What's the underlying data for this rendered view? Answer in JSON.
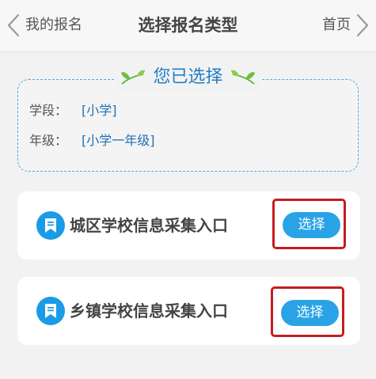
{
  "header": {
    "back_label": "我的报名",
    "title": "选择报名类型",
    "home_label": "首页"
  },
  "selection": {
    "title": "您已选择",
    "rows": [
      {
        "key": "学段：",
        "value": "[小学]"
      },
      {
        "key": "年级：",
        "value": "[小学一年级]"
      }
    ]
  },
  "entries": [
    {
      "label": "城区学校信息采集入口",
      "button": "选择"
    },
    {
      "label": "乡镇学校信息采集入口",
      "button": "选择"
    }
  ],
  "colors": {
    "accent": "#2aa3e6",
    "highlight_frame": "#c41d20",
    "title_blue": "#1e7fc8"
  }
}
